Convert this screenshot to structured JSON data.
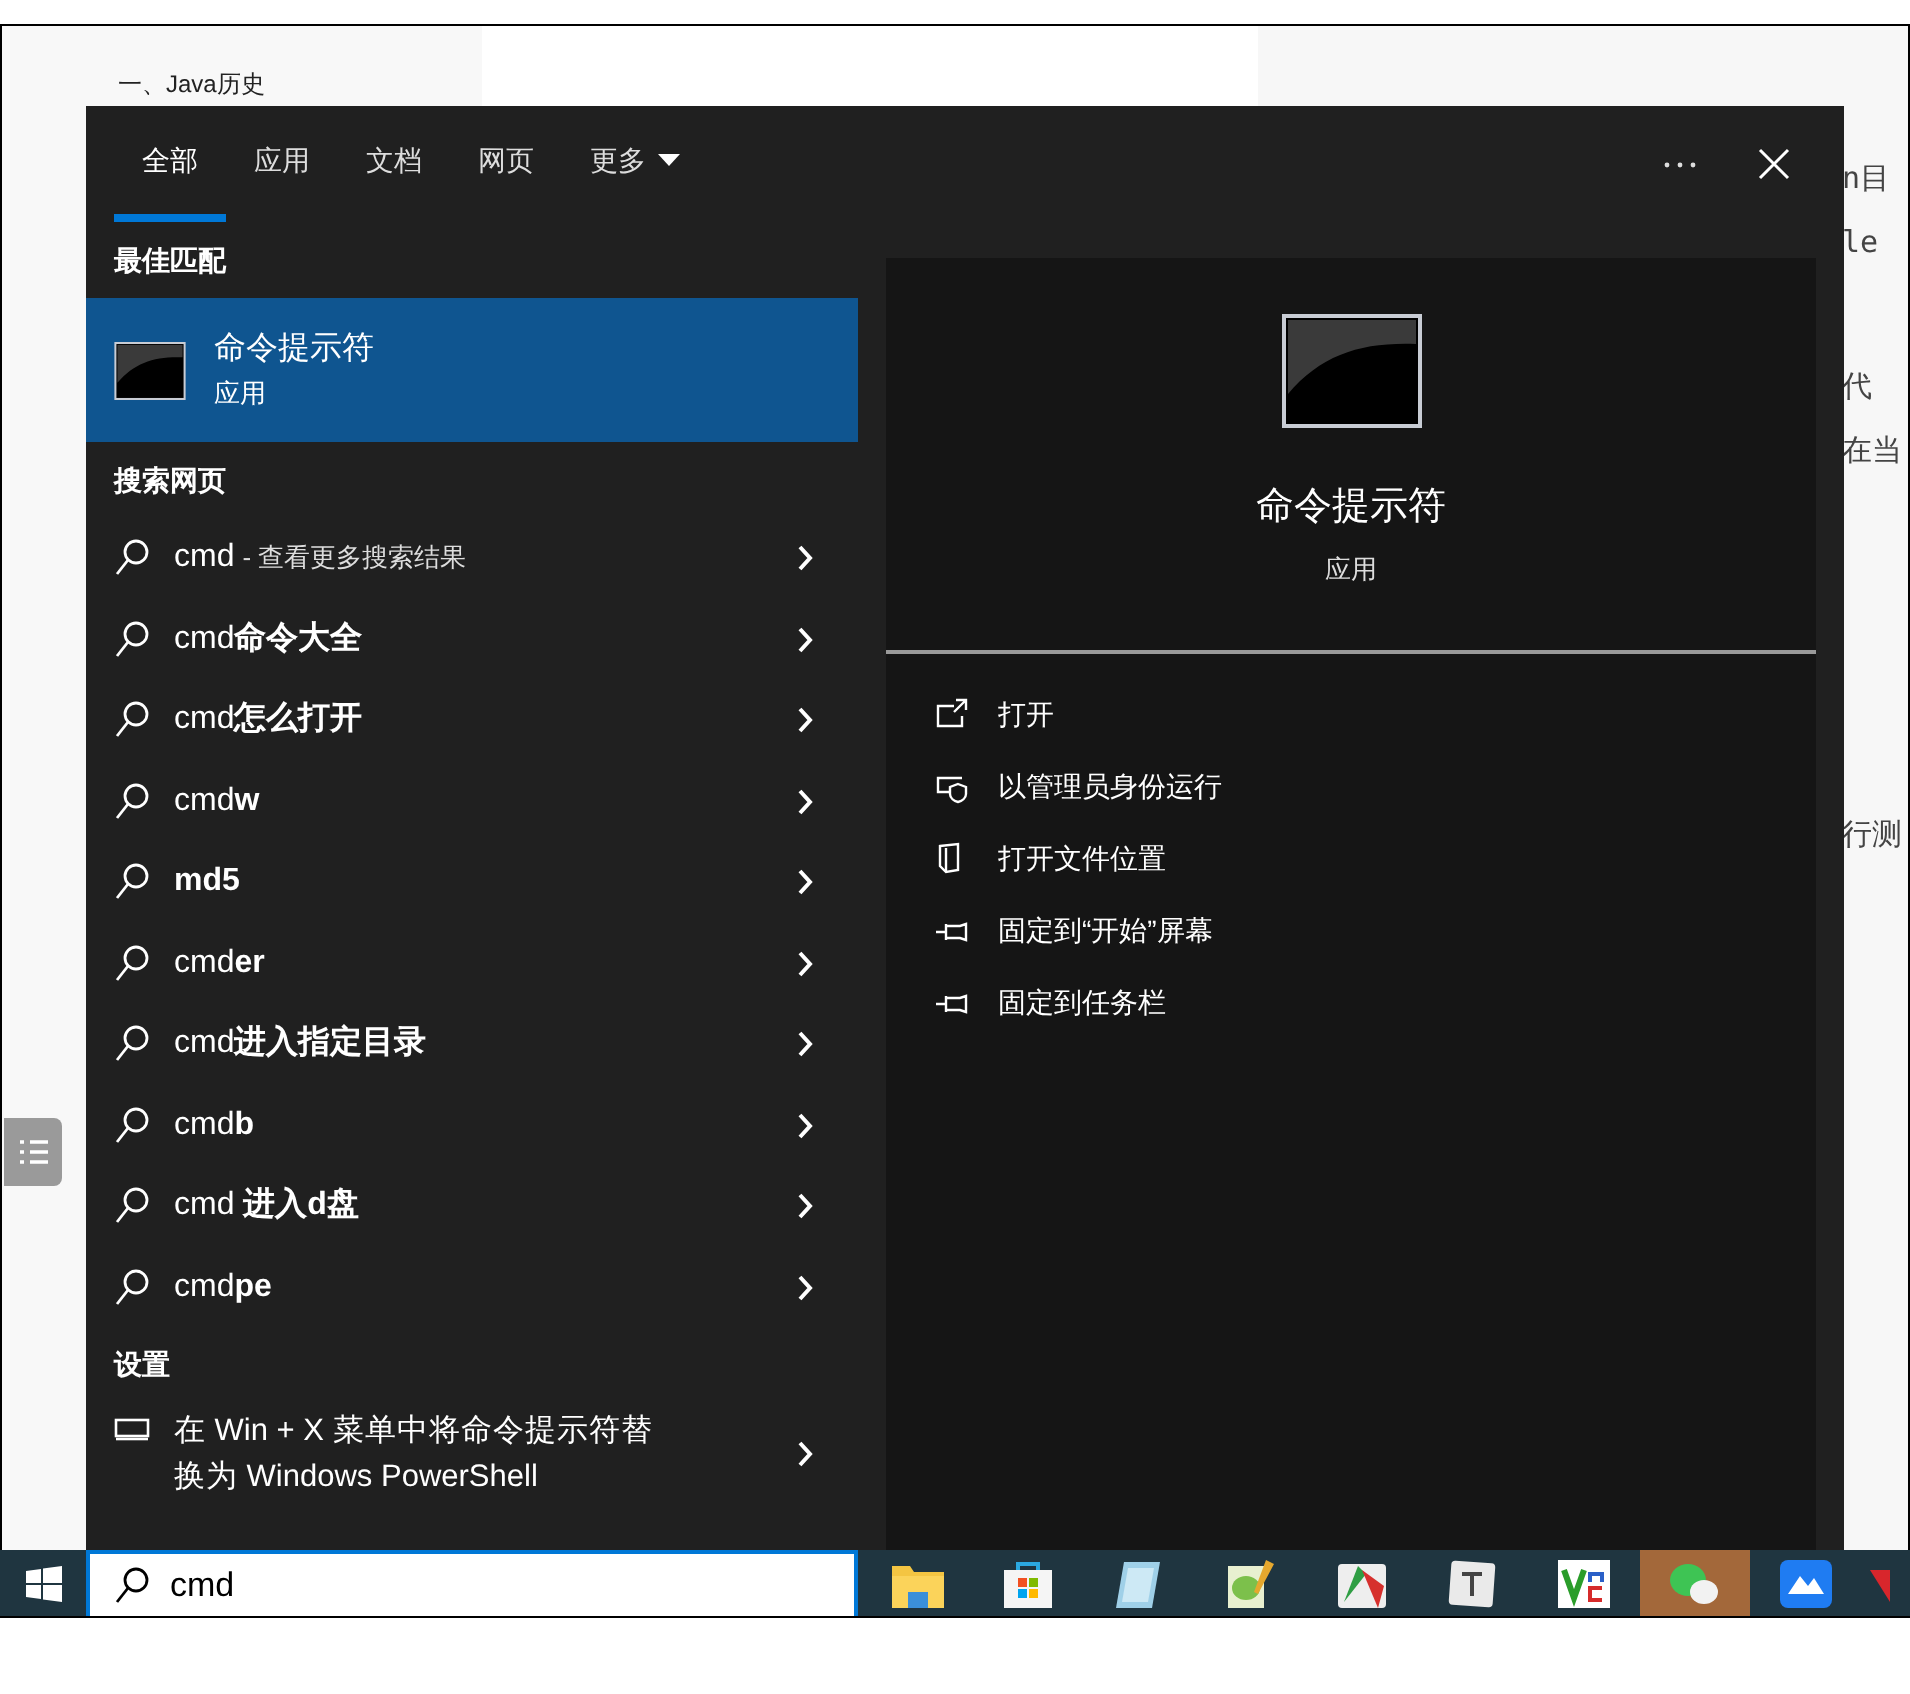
{
  "page": {
    "toc_item": "一、Java历史",
    "side_fragments": [
      "n目",
      "le",
      "代",
      "在当",
      "行测"
    ]
  },
  "start_menu": {
    "tabs": [
      {
        "label": "全部",
        "selected": true,
        "kind": "tab"
      },
      {
        "label": "应用",
        "selected": false,
        "kind": "tab"
      },
      {
        "label": "文档",
        "selected": false,
        "kind": "tab"
      },
      {
        "label": "网页",
        "selected": false,
        "kind": "tab"
      },
      {
        "label": "更多",
        "selected": false,
        "kind": "dropdown"
      }
    ],
    "best_match": {
      "heading": "最佳匹配",
      "name": "命令提示符",
      "type": "应用",
      "selected": true
    },
    "web": {
      "heading": "搜索网页",
      "items": [
        {
          "query": "cmd",
          "suffix": "- 查看更多搜索结果"
        },
        {
          "query": "cmd**命令大全**"
        },
        {
          "query": "cmd**怎么打开**"
        },
        {
          "query": "cmd**w**"
        },
        {
          "query": "**md5**"
        },
        {
          "query": "cmd**er**"
        },
        {
          "query": "cmd**进入指定目录**"
        },
        {
          "query": "cmd**b**"
        },
        {
          "query": "cmd **进入d盘**"
        },
        {
          "query": "cmd**pe**"
        }
      ]
    },
    "settings": {
      "heading": "设置",
      "items": [
        {
          "text": "在 Win + X 菜单中将命令提示符替换为 Windows PowerShell"
        }
      ]
    },
    "detail": {
      "name": "命令提示符",
      "type": "应用",
      "actions": [
        {
          "label": "打开",
          "kind": "open"
        },
        {
          "label": "以管理员身份运行",
          "kind": "admin"
        },
        {
          "label": "打开文件位置",
          "kind": "folder"
        },
        {
          "label": "固定到“开始”屏幕",
          "kind": "pin"
        },
        {
          "label": "固定到任务栏",
          "kind": "pin"
        }
      ]
    },
    "search": {
      "value": "cmd"
    }
  },
  "taskbar": {
    "apps": [
      {
        "kind": "folder",
        "selected": false
      },
      {
        "kind": "store",
        "selected": false
      },
      {
        "kind": "notepad",
        "selected": false
      },
      {
        "kind": "notepadpp",
        "selected": false
      },
      {
        "kind": "chart",
        "selected": false
      },
      {
        "kind": "typora",
        "selected": false
      },
      {
        "kind": "vnc",
        "selected": false
      },
      {
        "kind": "chat",
        "selected": true
      },
      {
        "kind": "cloud",
        "selected": false
      },
      {
        "kind": "red",
        "selected": false
      }
    ]
  }
}
